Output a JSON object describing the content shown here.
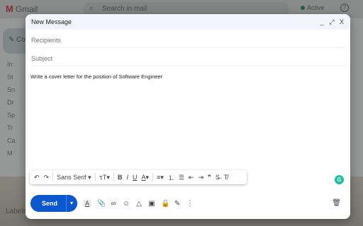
{
  "background": {
    "app_name": "Gmail",
    "search_placeholder": "Search in mail",
    "status": "Active",
    "compose_label": "Co",
    "sidebar_items": [
      "In",
      "St",
      "Sn",
      "Dr",
      "Sp",
      "Tr",
      "Ca",
      "M"
    ],
    "labels_heading": "Labels"
  },
  "compose": {
    "title": "New Message",
    "minimize": "_",
    "expand": "⤢",
    "close": "X",
    "recipients_placeholder": "Recipients",
    "subject_placeholder": "Subject",
    "body": "Write a cover letter for the position of Software Engineer"
  },
  "toolbar": {
    "undo": "↶",
    "redo": "↷",
    "font": "Sans Serif",
    "font_dropdown": "▾",
    "size": "ꚍT",
    "size_dropdown": "▾",
    "bold": "B",
    "italic": "I",
    "underline": "U",
    "text_color": "A",
    "text_color_dropdown": "▾",
    "align": "≡",
    "align_dropdown": "▾",
    "numbered_list": "⒈",
    "bulleted_list": "☰",
    "indent_less": "⇤",
    "indent_more": "⇥",
    "quote": "❞",
    "strikethrough": "S̶",
    "clear_formatting": "T̸"
  },
  "actions": {
    "send_label": "Send",
    "send_options": "▾",
    "formatting": "A",
    "attach": "📎",
    "link": "∞",
    "emoji": "☺",
    "drive": "△",
    "photo": "▣",
    "lock": "🔒",
    "signature": "✎",
    "more": "⋮",
    "trash": "🗑"
  },
  "grammarly": {
    "label": "G",
    "color": "#15c39a"
  },
  "colors": {
    "accent": "#0b57d0",
    "header_bg": "#f2f6fc"
  }
}
